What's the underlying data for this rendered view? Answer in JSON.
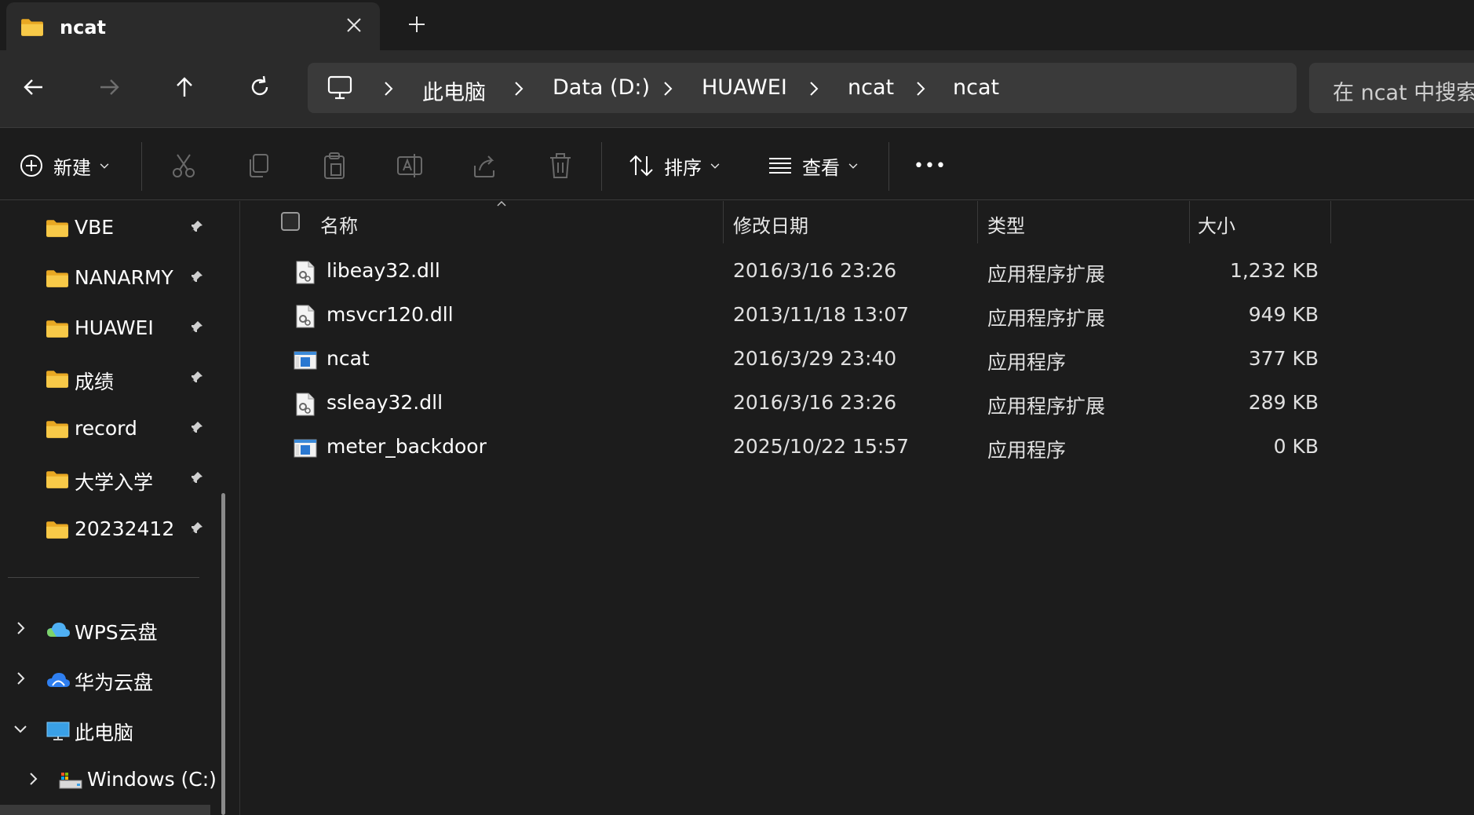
{
  "tab": {
    "title": "ncat"
  },
  "breadcrumb": [
    "此电脑",
    "Data (D:)",
    "HUAWEI",
    "ncat",
    "ncat"
  ],
  "search": {
    "placeholder": "在 ncat 中搜索"
  },
  "toolbar": {
    "new_label": "新建",
    "sort_label": "排序",
    "view_label": "查看",
    "more_label": "•••"
  },
  "sidebar": {
    "pinned": [
      {
        "label": "VBE"
      },
      {
        "label": "NANARMY"
      },
      {
        "label": "HUAWEI"
      },
      {
        "label": "成绩"
      },
      {
        "label": "record"
      },
      {
        "label": "大学入学"
      },
      {
        "label": "20232412"
      }
    ],
    "tree": [
      {
        "label": "WPS云盘",
        "icon": "wps-cloud-icon",
        "expanded": false
      },
      {
        "label": "华为云盘",
        "icon": "huawei-cloud-icon",
        "expanded": false
      },
      {
        "label": "此电脑",
        "icon": "this-pc-icon",
        "expanded": true
      },
      {
        "label": "Windows (C:)",
        "icon": "drive-c-icon",
        "expanded": false
      }
    ]
  },
  "columns": {
    "name": "名称",
    "modified": "修改日期",
    "type": "类型",
    "size": "大小"
  },
  "files": [
    {
      "name": "libeay32.dll",
      "modified": "2016/3/16 23:26",
      "type": "应用程序扩展",
      "size": "1,232 KB",
      "icon": "dll-icon"
    },
    {
      "name": "msvcr120.dll",
      "modified": "2013/11/18 13:07",
      "type": "应用程序扩展",
      "size": "949 KB",
      "icon": "dll-icon"
    },
    {
      "name": "ncat",
      "modified": "2016/3/29 23:40",
      "type": "应用程序",
      "size": "377 KB",
      "icon": "exe-icon"
    },
    {
      "name": "ssleay32.dll",
      "modified": "2016/3/16 23:26",
      "type": "应用程序扩展",
      "size": "289 KB",
      "icon": "dll-icon"
    },
    {
      "name": "meter_backdoor",
      "modified": "2025/10/22 15:57",
      "type": "应用程序",
      "size": "0 KB",
      "icon": "exe-icon"
    }
  ],
  "colors": {
    "background": "#1c1c1c",
    "toolbar": "#2b2b2b",
    "folder": "#f5c542",
    "accent": "#4aa3ff"
  }
}
